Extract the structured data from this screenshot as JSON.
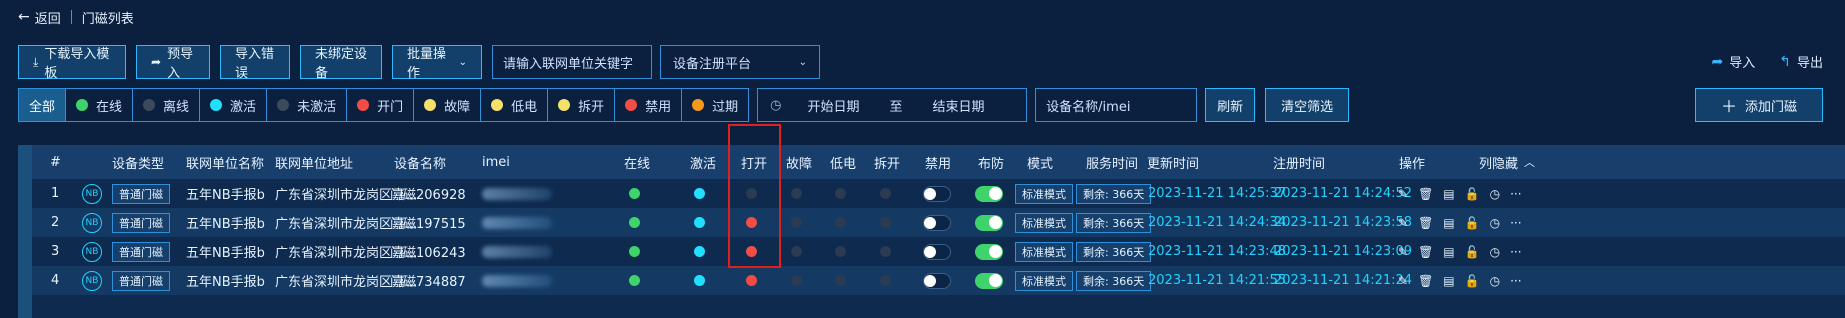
{
  "header": {
    "back_label": "返回",
    "page_title": "门磁列表"
  },
  "toolbar": {
    "download_template": "下载导入模板",
    "pre_import": "预导入",
    "import_errors": "导入错误",
    "unbound_devices": "未绑定设备",
    "batch_ops": "批量操作",
    "keyword_placeholder": "请输入联网单位关键字",
    "platform_placeholder": "设备注册平台",
    "import": "导入",
    "export": "导出"
  },
  "filters": [
    {
      "label": "全部",
      "color": ""
    },
    {
      "label": "在线",
      "color": "#3ed46b"
    },
    {
      "label": "离线",
      "color": "#3d4a5c"
    },
    {
      "label": "激活",
      "color": "#21e0ff"
    },
    {
      "label": "未激活",
      "color": "#3d4a5c"
    },
    {
      "label": "开门",
      "color": "#ef4d45"
    },
    {
      "label": "故障",
      "color": "#f5e06a"
    },
    {
      "label": "低电",
      "color": "#f5e06a"
    },
    {
      "label": "拆开",
      "color": "#f5e06a"
    },
    {
      "label": "禁用",
      "color": "#ef4d45"
    },
    {
      "label": "过期",
      "color": "#f59a1b"
    }
  ],
  "date": {
    "start": "开始日期",
    "to": "至",
    "end": "结束日期"
  },
  "search": {
    "device_placeholder": "设备名称/imei",
    "refresh": "刷新",
    "clear": "清空筛选",
    "add": "添加门磁"
  },
  "table": {
    "headers": [
      "#",
      "设备类型",
      "联网单位名称",
      "联网单位地址",
      "设备名称",
      "imei",
      "在线",
      "激活",
      "打开",
      "故障",
      "低电",
      "拆开",
      "禁用",
      "布防",
      "模式",
      "服务时间",
      "更新时间",
      "注册时间",
      "操作",
      "列隐藏"
    ],
    "rows": [
      {
        "no": "1",
        "nb": "NB",
        "type": "普通门磁",
        "unit": "五年NB手报b",
        "addr": "广东省深圳市龙岗区嘉...",
        "name": "门磁206928",
        "online": "#3ed46b",
        "active": "#21e0ff",
        "open": "#2a3b52",
        "fault": "#2a3b52",
        "lowbat": "#2a3b52",
        "tamper": "#2a3b52",
        "disabled": "off",
        "armed": "on",
        "mode": "标准模式",
        "service": "剩余: 366天",
        "updated": "2023-11-21 14:25:37",
        "registered": "2023-11-21 14:24:52"
      },
      {
        "no": "2",
        "nb": "NB",
        "type": "普通门磁",
        "unit": "五年NB手报b",
        "addr": "广东省深圳市龙岗区嘉...",
        "name": "门磁197515",
        "online": "#3ed46b",
        "active": "#21e0ff",
        "open": "#ef4d45",
        "fault": "#2a3b52",
        "lowbat": "#2a3b52",
        "tamper": "#2a3b52",
        "disabled": "off",
        "armed": "on",
        "mode": "标准模式",
        "service": "剩余: 366天",
        "updated": "2023-11-21 14:24:34",
        "registered": "2023-11-21 14:23:58"
      },
      {
        "no": "3",
        "nb": "NB",
        "type": "普通门磁",
        "unit": "五年NB手报b",
        "addr": "广东省深圳市龙岗区嘉...",
        "name": "门磁106243",
        "online": "#3ed46b",
        "active": "#21e0ff",
        "open": "#ef4d45",
        "fault": "#2a3b52",
        "lowbat": "#2a3b52",
        "tamper": "#2a3b52",
        "disabled": "off",
        "armed": "on",
        "mode": "标准模式",
        "service": "剩余: 366天",
        "updated": "2023-11-21 14:23:48",
        "registered": "2023-11-21 14:23:09"
      },
      {
        "no": "4",
        "nb": "NB",
        "type": "普通门磁",
        "unit": "五年NB手报b",
        "addr": "广东省深圳市龙岗区嘉...",
        "name": "门磁734887",
        "online": "#3ed46b",
        "active": "#21e0ff",
        "open": "#ef4d45",
        "fault": "#2a3b52",
        "lowbat": "#2a3b52",
        "tamper": "#2a3b52",
        "disabled": "off",
        "armed": "on",
        "mode": "标准模式",
        "service": "剩余: 366天",
        "updated": "2023-11-21 14:21:55",
        "registered": "2023-11-21 14:21:24"
      }
    ]
  }
}
